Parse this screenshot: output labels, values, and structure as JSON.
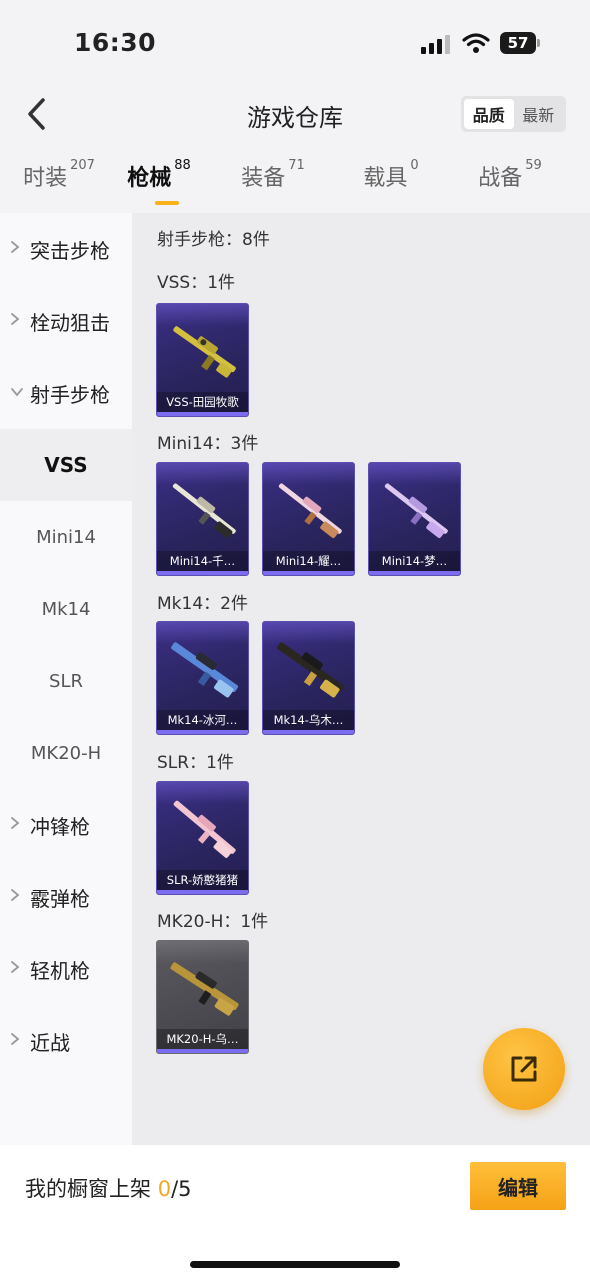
{
  "status": {
    "time": "16:30",
    "battery": "57"
  },
  "header": {
    "title": "游戏仓库",
    "sort_options": [
      "品质",
      "最新"
    ]
  },
  "tabs": [
    {
      "label": "时装",
      "count": "207"
    },
    {
      "label": "枪械",
      "count": "88"
    },
    {
      "label": "装备",
      "count": "71"
    },
    {
      "label": "载具",
      "count": "0"
    },
    {
      "label": "战备",
      "count": "59"
    }
  ],
  "sidebar": {
    "groups": [
      {
        "label": "突击步枪"
      },
      {
        "label": "栓动狙击"
      },
      {
        "label": "射手步枪"
      },
      {
        "label": "冲锋枪"
      },
      {
        "label": "霰弹枪"
      },
      {
        "label": "轻机枪"
      },
      {
        "label": "近战"
      }
    ],
    "subs": [
      "VSS",
      "Mini14",
      "Mk14",
      "SLR",
      "MK20-H"
    ]
  },
  "content": {
    "category_title": "射手步枪：8件",
    "groups": [
      {
        "title": "VSS：1件",
        "items": [
          "VSS-田园牧歌"
        ]
      },
      {
        "title": "Mini14：3件",
        "items": [
          "Mini14-千…",
          "Mini14-耀…",
          "Mini14-梦…"
        ]
      },
      {
        "title": "Mk14：2件",
        "items": [
          "Mk14-冰河…",
          "Mk14-乌木…"
        ]
      },
      {
        "title": "SLR：1件",
        "items": [
          "SLR-娇憨猪猪"
        ]
      },
      {
        "title": "MK20-H：1件",
        "items": [
          "MK20-H-乌…"
        ]
      }
    ]
  },
  "bottom": {
    "showcase_label": "我的橱窗上架",
    "showcase_count": "0",
    "showcase_total": "/5",
    "edit_label": "编辑"
  },
  "colors": {
    "accent": "#f5a623",
    "card_purple": "#2b2560",
    "card_gray": "#4a4a50"
  }
}
